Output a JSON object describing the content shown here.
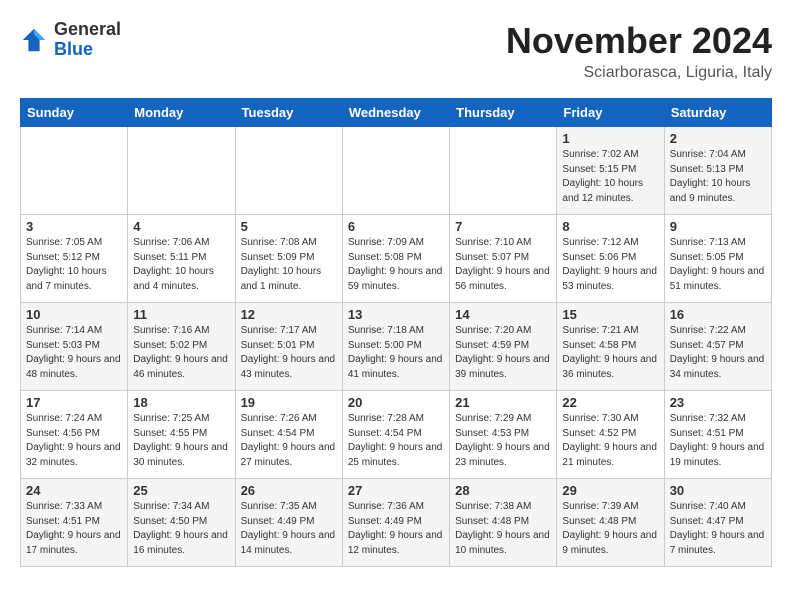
{
  "header": {
    "logo_general": "General",
    "logo_blue": "Blue",
    "month_title": "November 2024",
    "location": "Sciarborasca, Liguria, Italy"
  },
  "weekdays": [
    "Sunday",
    "Monday",
    "Tuesday",
    "Wednesday",
    "Thursday",
    "Friday",
    "Saturday"
  ],
  "weeks": [
    [
      {
        "day": "",
        "info": ""
      },
      {
        "day": "",
        "info": ""
      },
      {
        "day": "",
        "info": ""
      },
      {
        "day": "",
        "info": ""
      },
      {
        "day": "",
        "info": ""
      },
      {
        "day": "1",
        "info": "Sunrise: 7:02 AM\nSunset: 5:15 PM\nDaylight: 10 hours\nand 12 minutes."
      },
      {
        "day": "2",
        "info": "Sunrise: 7:04 AM\nSunset: 5:13 PM\nDaylight: 10 hours\nand 9 minutes."
      }
    ],
    [
      {
        "day": "3",
        "info": "Sunrise: 7:05 AM\nSunset: 5:12 PM\nDaylight: 10 hours\nand 7 minutes."
      },
      {
        "day": "4",
        "info": "Sunrise: 7:06 AM\nSunset: 5:11 PM\nDaylight: 10 hours\nand 4 minutes."
      },
      {
        "day": "5",
        "info": "Sunrise: 7:08 AM\nSunset: 5:09 PM\nDaylight: 10 hours\nand 1 minute."
      },
      {
        "day": "6",
        "info": "Sunrise: 7:09 AM\nSunset: 5:08 PM\nDaylight: 9 hours\nand 59 minutes."
      },
      {
        "day": "7",
        "info": "Sunrise: 7:10 AM\nSunset: 5:07 PM\nDaylight: 9 hours\nand 56 minutes."
      },
      {
        "day": "8",
        "info": "Sunrise: 7:12 AM\nSunset: 5:06 PM\nDaylight: 9 hours\nand 53 minutes."
      },
      {
        "day": "9",
        "info": "Sunrise: 7:13 AM\nSunset: 5:05 PM\nDaylight: 9 hours\nand 51 minutes."
      }
    ],
    [
      {
        "day": "10",
        "info": "Sunrise: 7:14 AM\nSunset: 5:03 PM\nDaylight: 9 hours\nand 48 minutes."
      },
      {
        "day": "11",
        "info": "Sunrise: 7:16 AM\nSunset: 5:02 PM\nDaylight: 9 hours\nand 46 minutes."
      },
      {
        "day": "12",
        "info": "Sunrise: 7:17 AM\nSunset: 5:01 PM\nDaylight: 9 hours\nand 43 minutes."
      },
      {
        "day": "13",
        "info": "Sunrise: 7:18 AM\nSunset: 5:00 PM\nDaylight: 9 hours\nand 41 minutes."
      },
      {
        "day": "14",
        "info": "Sunrise: 7:20 AM\nSunset: 4:59 PM\nDaylight: 9 hours\nand 39 minutes."
      },
      {
        "day": "15",
        "info": "Sunrise: 7:21 AM\nSunset: 4:58 PM\nDaylight: 9 hours\nand 36 minutes."
      },
      {
        "day": "16",
        "info": "Sunrise: 7:22 AM\nSunset: 4:57 PM\nDaylight: 9 hours\nand 34 minutes."
      }
    ],
    [
      {
        "day": "17",
        "info": "Sunrise: 7:24 AM\nSunset: 4:56 PM\nDaylight: 9 hours\nand 32 minutes."
      },
      {
        "day": "18",
        "info": "Sunrise: 7:25 AM\nSunset: 4:55 PM\nDaylight: 9 hours\nand 30 minutes."
      },
      {
        "day": "19",
        "info": "Sunrise: 7:26 AM\nSunset: 4:54 PM\nDaylight: 9 hours\nand 27 minutes."
      },
      {
        "day": "20",
        "info": "Sunrise: 7:28 AM\nSunset: 4:54 PM\nDaylight: 9 hours\nand 25 minutes."
      },
      {
        "day": "21",
        "info": "Sunrise: 7:29 AM\nSunset: 4:53 PM\nDaylight: 9 hours\nand 23 minutes."
      },
      {
        "day": "22",
        "info": "Sunrise: 7:30 AM\nSunset: 4:52 PM\nDaylight: 9 hours\nand 21 minutes."
      },
      {
        "day": "23",
        "info": "Sunrise: 7:32 AM\nSunset: 4:51 PM\nDaylight: 9 hours\nand 19 minutes."
      }
    ],
    [
      {
        "day": "24",
        "info": "Sunrise: 7:33 AM\nSunset: 4:51 PM\nDaylight: 9 hours\nand 17 minutes."
      },
      {
        "day": "25",
        "info": "Sunrise: 7:34 AM\nSunset: 4:50 PM\nDaylight: 9 hours\nand 16 minutes."
      },
      {
        "day": "26",
        "info": "Sunrise: 7:35 AM\nSunset: 4:49 PM\nDaylight: 9 hours\nand 14 minutes."
      },
      {
        "day": "27",
        "info": "Sunrise: 7:36 AM\nSunset: 4:49 PM\nDaylight: 9 hours\nand 12 minutes."
      },
      {
        "day": "28",
        "info": "Sunrise: 7:38 AM\nSunset: 4:48 PM\nDaylight: 9 hours\nand 10 minutes."
      },
      {
        "day": "29",
        "info": "Sunrise: 7:39 AM\nSunset: 4:48 PM\nDaylight: 9 hours\nand 9 minutes."
      },
      {
        "day": "30",
        "info": "Sunrise: 7:40 AM\nSunset: 4:47 PM\nDaylight: 9 hours\nand 7 minutes."
      }
    ]
  ]
}
